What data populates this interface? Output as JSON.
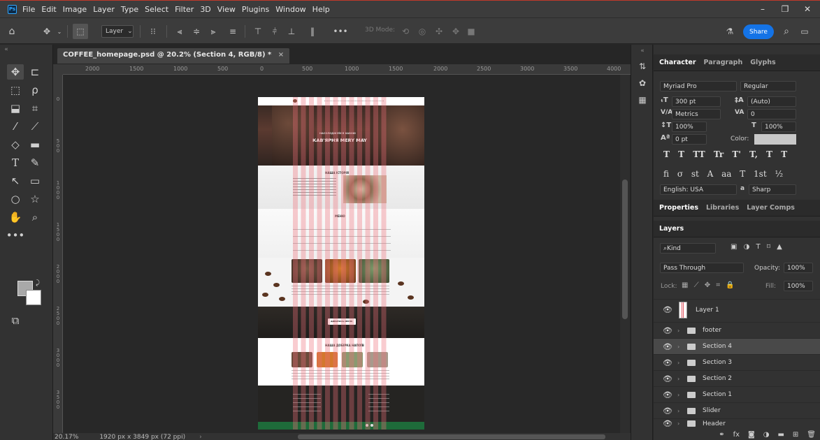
{
  "menubar": {
    "logo": "Ps",
    "items": [
      "File",
      "Edit",
      "Image",
      "Layer",
      "Type",
      "Select",
      "Filter",
      "3D",
      "View",
      "Plugins",
      "Window",
      "Help"
    ],
    "minimize": "–",
    "restore": "❐",
    "close": "✕"
  },
  "options": {
    "layer_select": "Layer",
    "mode_3d": "3D Mode:",
    "share": "Share",
    "more": "•••"
  },
  "document": {
    "tab_title": "COFFEE_homepage.psd @ 20.2% (Section 4, RGB/8) *",
    "tab_close": "×",
    "zoom": "20.17%",
    "size": "1920 px x 3849 px (72 ppi)"
  },
  "ruler": {
    "h_ticks": [
      "2000",
      "1500",
      "1000",
      "500",
      "0",
      "500",
      "1000",
      "1500",
      "2000",
      "2500",
      "3000",
      "3500",
      "4000"
    ],
    "v_ticks": [
      "0",
      "5 0 0",
      "1 0 0 0",
      "1 5 0 0",
      "2 0 0 0",
      "2 5 0 0",
      "3 0 0 0",
      "3 5 0 0"
    ]
  },
  "artboard": {
    "hero_subtitle": "НАСОЛОДЖУЙСЯ КАВОЮ",
    "hero_title": "КАВ'ЯРНЯ MERY MAY",
    "section_title": "НАША ІСТОРІЯ",
    "menu_title": "МЕНЮ",
    "menu_btn": "ДИВИТИСЬ МЕНЮ",
    "products_title": "НАША ДОБІРКА НАПОЇВ"
  },
  "character_panel": {
    "tabs": [
      "Character",
      "Paragraph",
      "Glyphs"
    ],
    "font_family": "Myriad Pro",
    "font_style": "Regular",
    "size": "300 pt",
    "leading": "(Auto)",
    "kerning": "Metrics",
    "tracking": "0",
    "vscale": "100%",
    "hscale": "100%",
    "baseline": "0 pt",
    "color_label": "Color:",
    "color_value": "#c8c8c8",
    "language": "English: USA",
    "aa_label": "a",
    "antialias": "Sharp",
    "type_row1": "T T TT Tr T' T, T T",
    "type_row2": "fi σ st A aa T 1st ½"
  },
  "props_tabs": [
    "Properties",
    "Libraries",
    "Layer Comps"
  ],
  "layers": {
    "tab": "Layers",
    "filter": "Kind",
    "blend": "Pass Through",
    "opacity_label": "Opacity:",
    "opacity": "100%",
    "lock_label": "Lock:",
    "fill_label": "Fill:",
    "fill": "100%",
    "items": [
      {
        "name": "Layer 1",
        "type": "layer"
      },
      {
        "name": "footer",
        "type": "group"
      },
      {
        "name": "Section 4",
        "type": "group",
        "selected": true
      },
      {
        "name": "Section 3",
        "type": "group"
      },
      {
        "name": "Section 2",
        "type": "group"
      },
      {
        "name": "Section 1",
        "type": "group"
      },
      {
        "name": "Slider",
        "type": "group"
      },
      {
        "name": "Header",
        "type": "group"
      }
    ]
  }
}
